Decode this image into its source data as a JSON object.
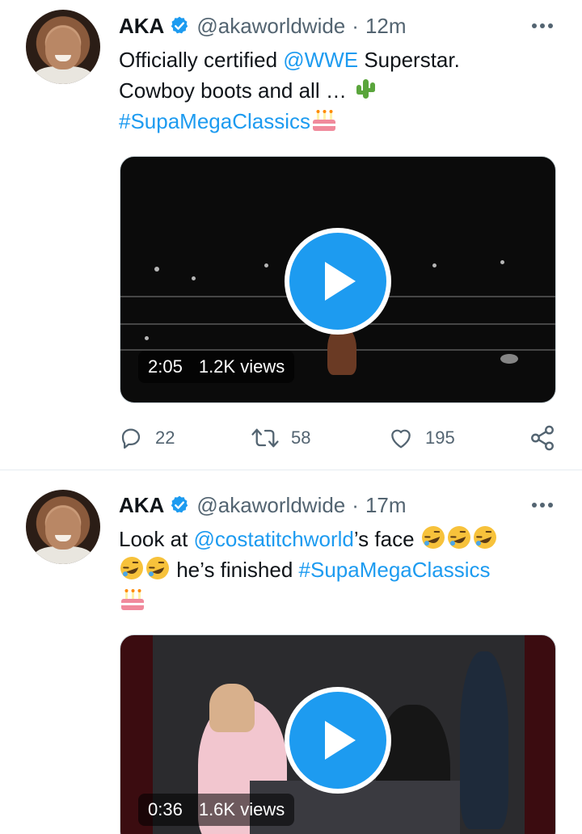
{
  "tweets": [
    {
      "name": "AKA",
      "handle": "@akaworldwide",
      "separator": "·",
      "time": "12m",
      "text": {
        "line1_pre": "Officially certified ",
        "line1_mention": "@WWE",
        "line1_post": " Superstar.",
        "line2": "Cowboy boots and all … ",
        "line3_hashtag": "#SupaMegaClassics"
      },
      "video": {
        "duration": "2:05",
        "views": "1.2K views"
      },
      "actions": {
        "replies": "22",
        "retweets": "58",
        "likes": "195"
      }
    },
    {
      "name": "AKA",
      "handle": "@akaworldwide",
      "separator": "·",
      "time": "17m",
      "text": {
        "line1_pre": "Look at ",
        "line1_mention": "@costatitchworld",
        "line1_post": "’s face ",
        "line2_post": " he’s finished ",
        "line2_hashtag": "#SupaMegaClassics"
      },
      "video": {
        "duration": "0:36",
        "views": "1.6K views"
      }
    }
  ],
  "icons": {
    "verified": "verified-badge-icon",
    "more": "more-options-icon",
    "reply": "reply-icon",
    "retweet": "retweet-icon",
    "like": "like-icon",
    "share": "share-icon",
    "play": "play-icon"
  },
  "colors": {
    "accent": "#1d9bf0",
    "text": "#0f1419",
    "secondary": "#536471"
  }
}
